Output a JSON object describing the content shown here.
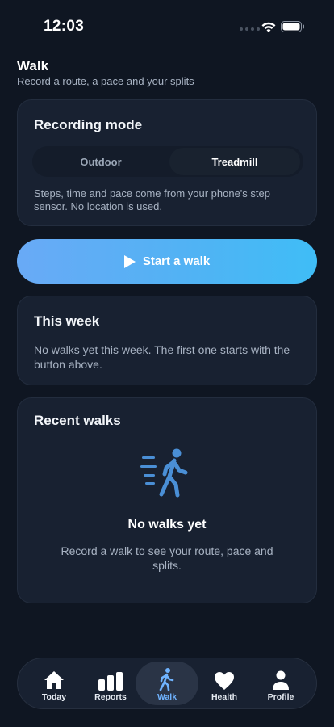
{
  "status": {
    "time": "12:03"
  },
  "header": {
    "title": "Walk",
    "subtitle": "Record a route, a pace and your splits"
  },
  "recording_mode": {
    "title": "Recording mode",
    "options": [
      "Outdoor",
      "Treadmill"
    ],
    "selected": "Treadmill",
    "description": "Steps, time and pace come from your phone's step sensor. No location is used."
  },
  "start_button": {
    "label": "Start a walk"
  },
  "this_week": {
    "title": "This week",
    "text": "No walks yet this week. The first one starts with the button above."
  },
  "recent_walks": {
    "title": "Recent walks",
    "empty_icon": "walking-person-icon",
    "empty_title": "No walks yet",
    "empty_text": "Record a walk to see your route, pace and splits."
  },
  "tab_bar": {
    "items": [
      {
        "label": "Today",
        "icon": "home-icon"
      },
      {
        "label": "Reports",
        "icon": "bar-chart-icon"
      },
      {
        "label": "Walk",
        "icon": "walk-icon"
      },
      {
        "label": "Health",
        "icon": "heart-icon"
      },
      {
        "label": "Profile",
        "icon": "person-icon"
      }
    ],
    "active": "Walk"
  },
  "colors": {
    "background": "#0f1622",
    "card": "#182131",
    "accent": "#5aaef5",
    "active_tab": "#6fb3ff"
  }
}
